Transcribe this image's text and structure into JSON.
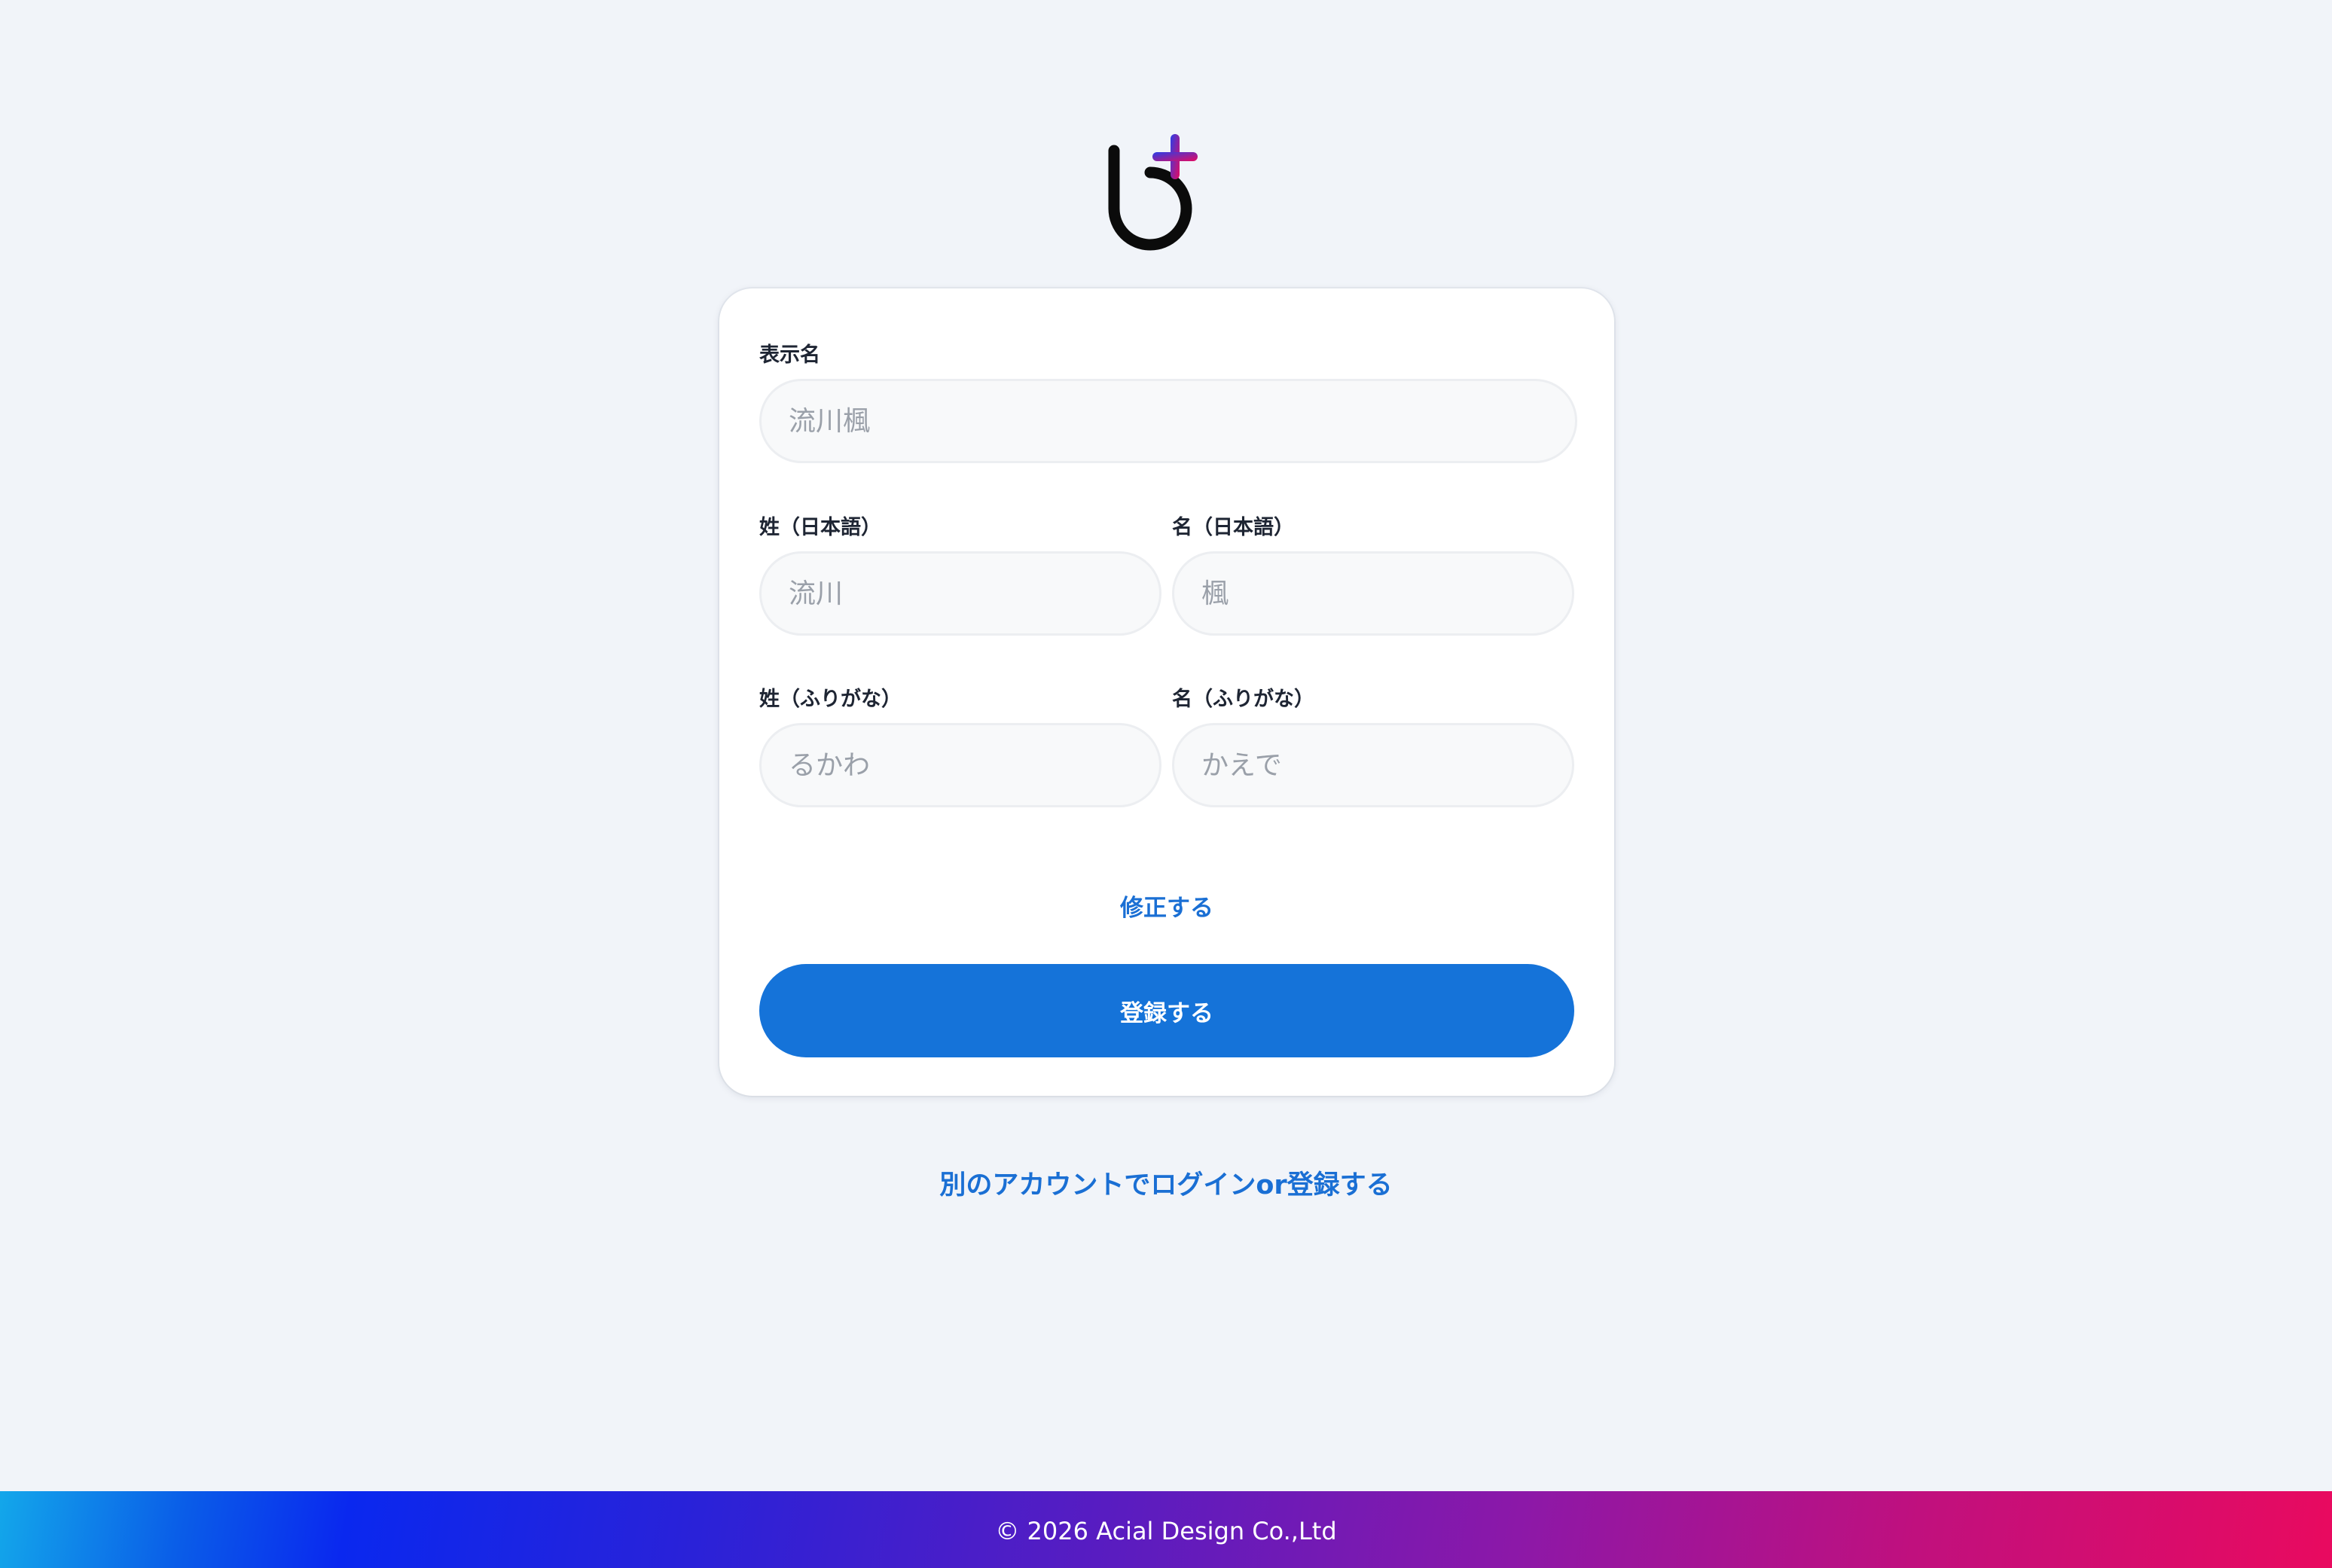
{
  "brand": {
    "logo_icon": "b-plus-logo",
    "colors": {
      "accent": "#1573d9",
      "link": "#1a6fd4",
      "background": "#f1f4f9",
      "logo_plus_start": "#2a3ee8",
      "logo_plus_end": "#e40a62"
    }
  },
  "form": {
    "display_name": {
      "label": "表示名",
      "placeholder": "流川楓"
    },
    "last_name_ja": {
      "label": "姓（日本語）",
      "placeholder": "流川"
    },
    "first_name_ja": {
      "label": "名（日本語）",
      "placeholder": "楓"
    },
    "last_name_kana": {
      "label": "姓（ふりがな）",
      "placeholder": "るかわ"
    },
    "first_name_kana": {
      "label": "名（ふりがな）",
      "placeholder": "かえで"
    },
    "edit_link": "修正する",
    "submit_label": "登録する"
  },
  "alt_account_link": "別のアカウントでログインor登録する",
  "footer": {
    "copyright": "© 2026 Acial Design Co.,Ltd"
  }
}
